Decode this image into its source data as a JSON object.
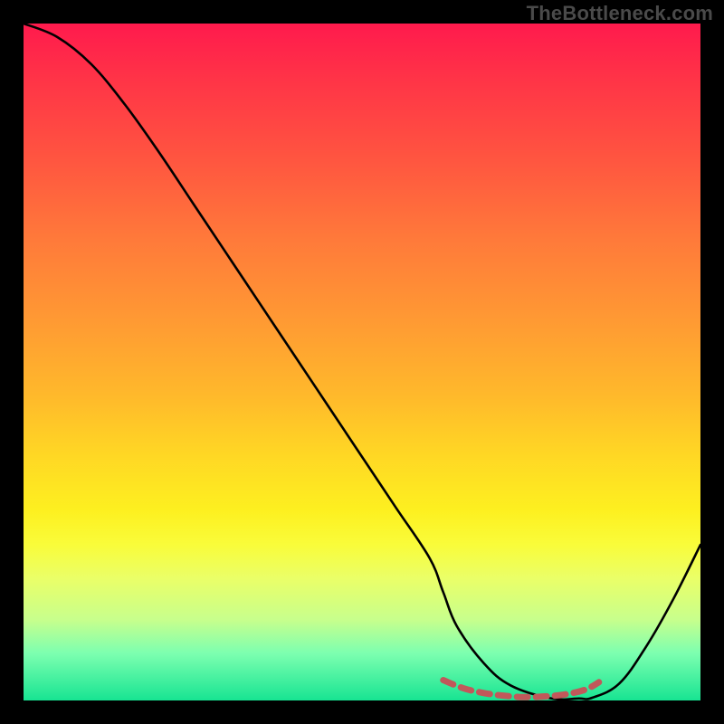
{
  "watermark": "TheBottleneck.com",
  "chart_data": {
    "type": "line",
    "title": "",
    "xlabel": "",
    "ylabel": "",
    "xlim": [
      0,
      100
    ],
    "ylim": [
      0,
      100
    ],
    "grid": false,
    "legend": false,
    "annotations": [],
    "series": [
      {
        "name": "bottleneck-curve",
        "color": "#000000",
        "x": [
          0,
          5,
          10,
          15,
          20,
          25,
          30,
          35,
          40,
          45,
          50,
          55,
          60,
          62,
          64,
          68,
          72,
          78,
          82,
          84,
          88,
          92,
          96,
          100
        ],
        "y": [
          100,
          98,
          94,
          88,
          81,
          73.5,
          66,
          58.5,
          51,
          43.5,
          36,
          28.5,
          21,
          16,
          11,
          5.5,
          2.2,
          0.3,
          0.3,
          0.4,
          2.5,
          8,
          15,
          23
        ]
      },
      {
        "name": "optimal-zone",
        "color": "#c1585a",
        "style": "dashed",
        "x": [
          62,
          65,
          68,
          71,
          74,
          77,
          80,
          83,
          85
        ],
        "y": [
          3.0,
          1.8,
          1.1,
          0.7,
          0.5,
          0.6,
          0.9,
          1.6,
          2.7
        ]
      }
    ],
    "background": {
      "type": "vertical-gradient",
      "stops": [
        {
          "pos": 0,
          "color": "#ff1a4d"
        },
        {
          "pos": 20,
          "color": "#ff5540"
        },
        {
          "pos": 44,
          "color": "#ff9a33"
        },
        {
          "pos": 64,
          "color": "#ffd824"
        },
        {
          "pos": 82,
          "color": "#eaff68"
        },
        {
          "pos": 100,
          "color": "#17e492"
        }
      ]
    }
  }
}
